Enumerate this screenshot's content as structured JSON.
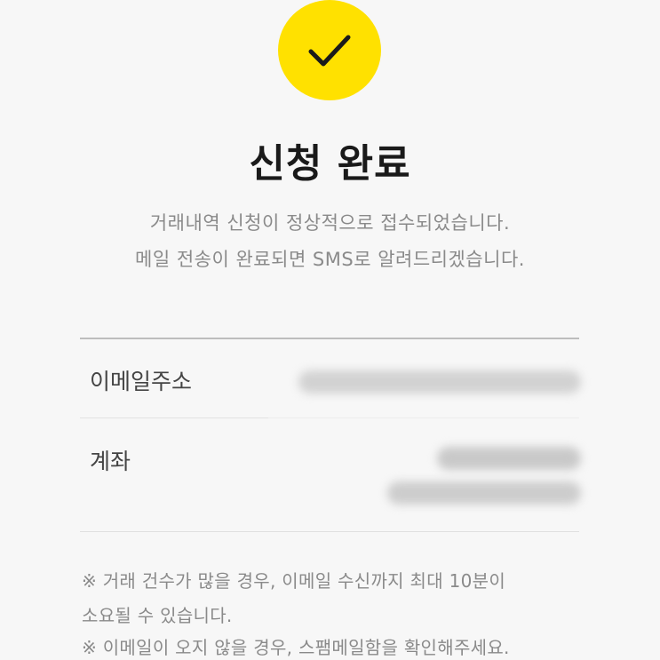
{
  "status": {
    "icon": "check-icon",
    "accent_color": "#ffe100"
  },
  "header": {
    "title": "신청 완료",
    "subtitle_line1": "거래내역 신청이 정상적으로 접수되었습니다.",
    "subtitle_line2": "메일 전송이 완료되면 SMS로 알려드리겠습니다."
  },
  "details": {
    "email_label": "이메일주소",
    "account_label": "계좌"
  },
  "notes": {
    "line1": "※ 거래 건수가 많을 경우, 이메일 수신까지 최대 10분이",
    "line2": "소요될 수 있습니다.",
    "line3": "※ 이메일이 오지 않을 경우, 스팸메일함을 확인해주세요."
  }
}
